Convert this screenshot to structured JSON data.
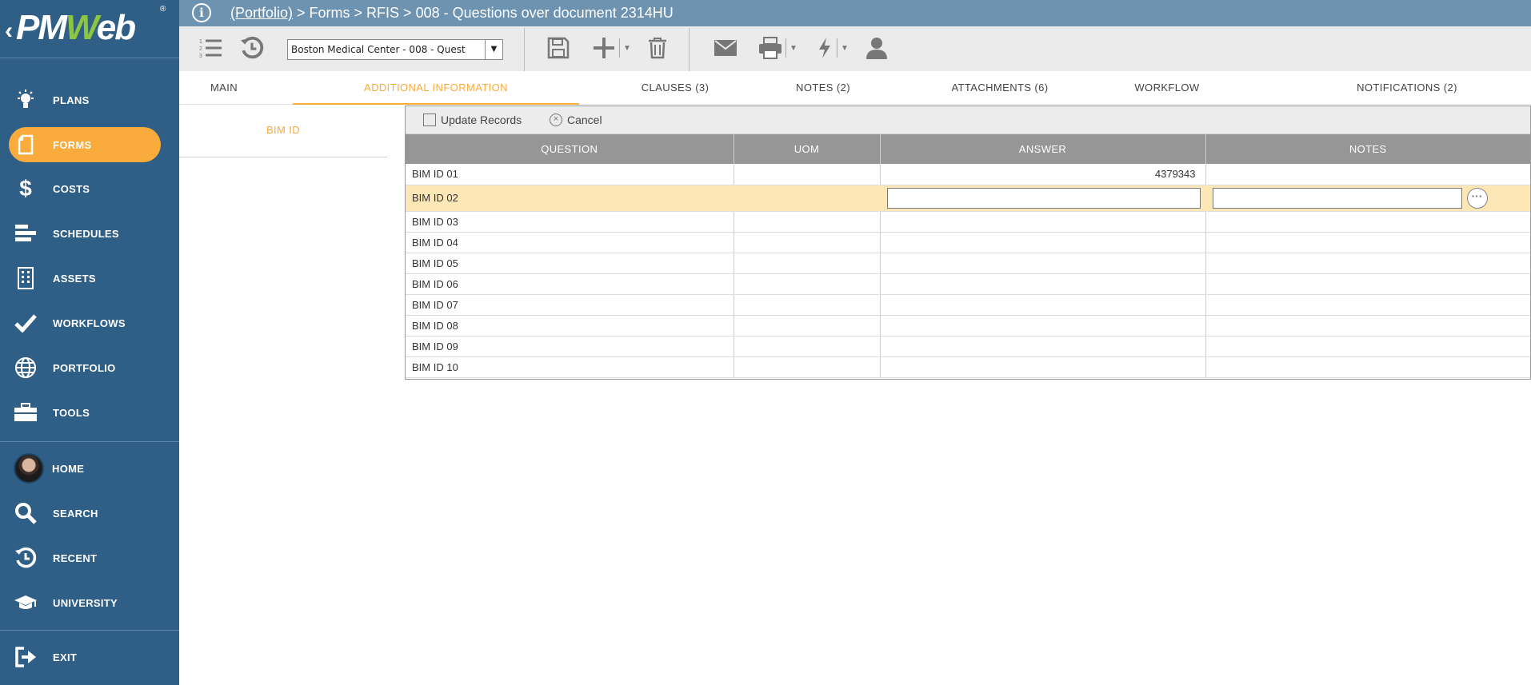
{
  "app": {
    "logo_text_pre": "PM",
    "logo_text_w": "W",
    "logo_text_post": "eb",
    "logo_reg": "®"
  },
  "sidebar": {
    "items": [
      {
        "label": "PLANS",
        "icon": "lightbulb-icon"
      },
      {
        "label": "FORMS",
        "icon": "document-icon",
        "active": true
      },
      {
        "label": "COSTS",
        "icon": "dollar-icon"
      },
      {
        "label": "SCHEDULES",
        "icon": "gantt-bars-icon"
      },
      {
        "label": "ASSETS",
        "icon": "building-icon"
      },
      {
        "label": "WORKFLOWS",
        "icon": "checkmark-icon"
      },
      {
        "label": "PORTFOLIO",
        "icon": "globe-icon"
      },
      {
        "label": "TOOLS",
        "icon": "toolbox-icon"
      },
      {
        "label": "HOME",
        "icon": "avatar"
      },
      {
        "label": "SEARCH",
        "icon": "search-icon"
      },
      {
        "label": "RECENT",
        "icon": "history-icon"
      },
      {
        "label": "UNIVERSITY",
        "icon": "graduation-cap-icon"
      },
      {
        "label": "EXIT",
        "icon": "exit-icon"
      }
    ]
  },
  "header": {
    "info_glyph": "i",
    "breadcrumb_link": "(Portfolio)",
    "breadcrumb_rest": " > Forms > RFIS > 008 - Questions over document 2314HU"
  },
  "toolbar": {
    "project_select_value": "Boston Medical Center - 008 - Quest",
    "icons": [
      "numbered-list-icon",
      "history-icon",
      "save-icon",
      "add-icon",
      "delete-icon",
      "email-icon",
      "print-icon",
      "lightning-icon",
      "user-icon"
    ]
  },
  "tabs": [
    {
      "label": "MAIN"
    },
    {
      "label": "ADDITIONAL INFORMATION",
      "active": true
    },
    {
      "label": "CLAUSES (3)"
    },
    {
      "label": "NOTES (2)"
    },
    {
      "label": "ATTACHMENTS (6)"
    },
    {
      "label": "WORKFLOW"
    },
    {
      "label": "NOTIFICATIONS (2)"
    }
  ],
  "subpane": {
    "item_label": "BIM ID"
  },
  "grid": {
    "update_label": "Update Records",
    "cancel_label": "Cancel",
    "columns": [
      "QUESTION",
      "UOM",
      "ANSWER",
      "NOTES"
    ],
    "rows": [
      {
        "question": "BIM ID 01",
        "uom": "",
        "answer": "4379343",
        "notes": ""
      },
      {
        "question": "BIM ID 02",
        "uom": "",
        "answer": "",
        "notes": "",
        "editing": true
      },
      {
        "question": "BIM ID 03",
        "uom": "",
        "answer": "",
        "notes": ""
      },
      {
        "question": "BIM ID 04",
        "uom": "",
        "answer": "",
        "notes": ""
      },
      {
        "question": "BIM ID 05",
        "uom": "",
        "answer": "",
        "notes": ""
      },
      {
        "question": "BIM ID 06",
        "uom": "",
        "answer": "",
        "notes": ""
      },
      {
        "question": "BIM ID 07",
        "uom": "",
        "answer": "",
        "notes": ""
      },
      {
        "question": "BIM ID 08",
        "uom": "",
        "answer": "",
        "notes": ""
      },
      {
        "question": "BIM ID 09",
        "uom": "",
        "answer": "",
        "notes": ""
      },
      {
        "question": "BIM ID 10",
        "uom": "",
        "answer": "",
        "notes": ""
      }
    ]
  },
  "colors": {
    "sidebar_bg": "#2f5f86",
    "header_bg": "#6d93b0",
    "accent": "#f9ab3c",
    "edit_row": "#fde7b6",
    "grid_header": "#969696"
  }
}
